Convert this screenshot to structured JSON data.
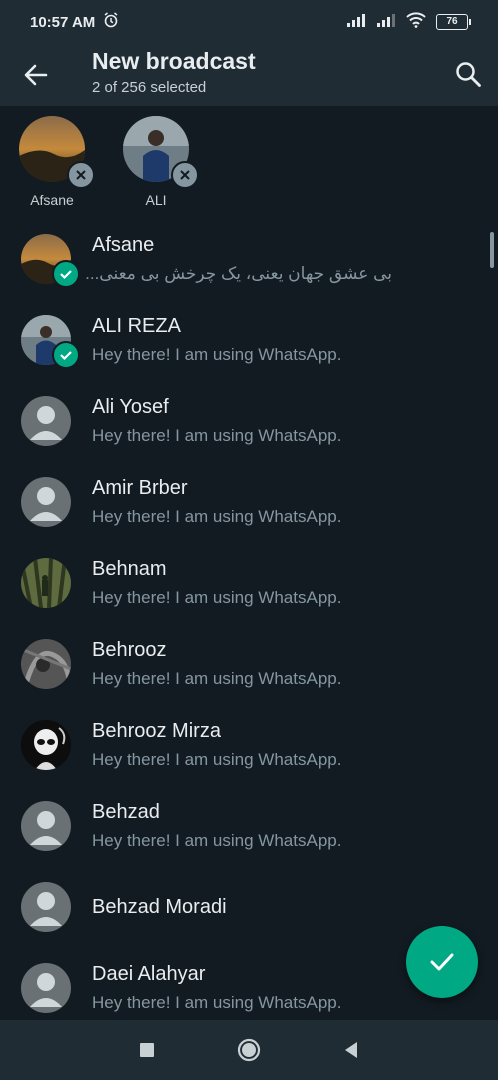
{
  "status_bar": {
    "time": "10:57 AM",
    "battery": "76"
  },
  "header": {
    "title": "New broadcast",
    "subtitle": "2 of 256 selected"
  },
  "selected": [
    {
      "label": "Afsane",
      "avatar": "landscape-photo"
    },
    {
      "label": "ALI",
      "avatar": "person-photo"
    }
  ],
  "contacts": [
    {
      "name": "Afsane",
      "about": "بی عشق جهان یعنی، یک چرخش بی معنی...",
      "avatar": "landscape-photo",
      "selected": true
    },
    {
      "name": "ALI REZA",
      "about": "Hey there! I am using WhatsApp.",
      "avatar": "person-photo",
      "selected": true
    },
    {
      "name": "Ali Yosef",
      "about": "Hey there! I am using WhatsApp.",
      "avatar": "default-avatar"
    },
    {
      "name": "Amir Brber",
      "about": "Hey there! I am using WhatsApp.",
      "avatar": "default-avatar"
    },
    {
      "name": "Behnam",
      "about": "Hey there! I am using WhatsApp.",
      "avatar": "forest-photo"
    },
    {
      "name": "Behrooz",
      "about": "Hey there! I am using WhatsApp.",
      "avatar": "bw-photo"
    },
    {
      "name": "Behrooz Mirza",
      "about": "Hey there! I am using WhatsApp.",
      "avatar": "cartoon-photo"
    },
    {
      "name": "Behzad",
      "about": "Hey there! I am using WhatsApp.",
      "avatar": "default-avatar"
    },
    {
      "name": "Behzad Moradi",
      "about": "",
      "avatar": "default-avatar"
    },
    {
      "name": "Daei Alahyar",
      "about": "Hey there! I am using WhatsApp.",
      "avatar": "default-avatar"
    }
  ],
  "colors": {
    "accent": "#00a884",
    "background": "#121b22",
    "toolbar": "#1f2c34",
    "secondary_text": "#8696a0"
  },
  "icons": {
    "back": "arrow-left-icon",
    "search": "search-icon",
    "fab": "check-icon"
  }
}
